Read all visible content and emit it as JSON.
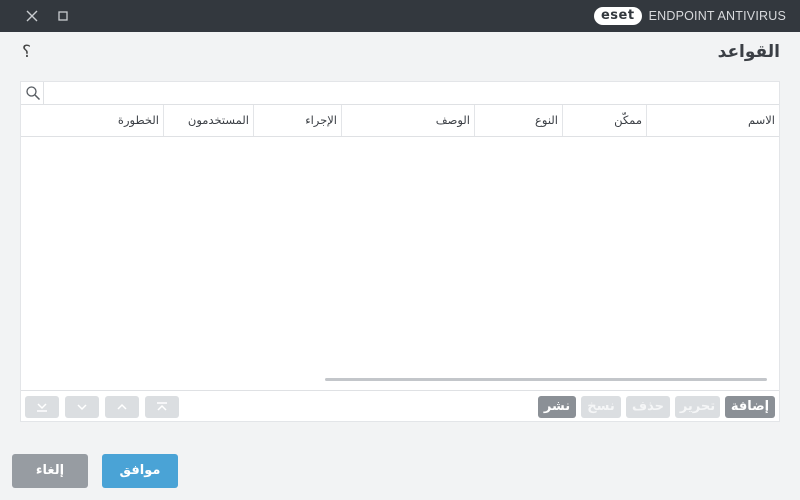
{
  "titlebar": {
    "brand_logo": "eset",
    "brand_name": "ENDPOINT ANTIVIRUS",
    "bg_color": "#33383e"
  },
  "page": {
    "title": "القواعد",
    "help_glyph": "؟"
  },
  "search": {
    "value": "",
    "placeholder": ""
  },
  "table": {
    "columns": [
      "الاسم",
      "ممكّن",
      "النوع",
      "الوصف",
      "الإجراء",
      "المستخدمون",
      "الخطورة"
    ],
    "rows": []
  },
  "toolbar": {
    "add_label": "إضافة",
    "edit_label": "تحرير",
    "delete_label": "حذف",
    "copy_label": "نسخ",
    "publish_label": "نشر"
  },
  "footer": {
    "ok_label": "موافق",
    "cancel_label": "إلغاء"
  },
  "colors": {
    "accent": "#4aa3d6",
    "button_dark": "#8b9096",
    "button_disabled": "#dbdee1"
  }
}
